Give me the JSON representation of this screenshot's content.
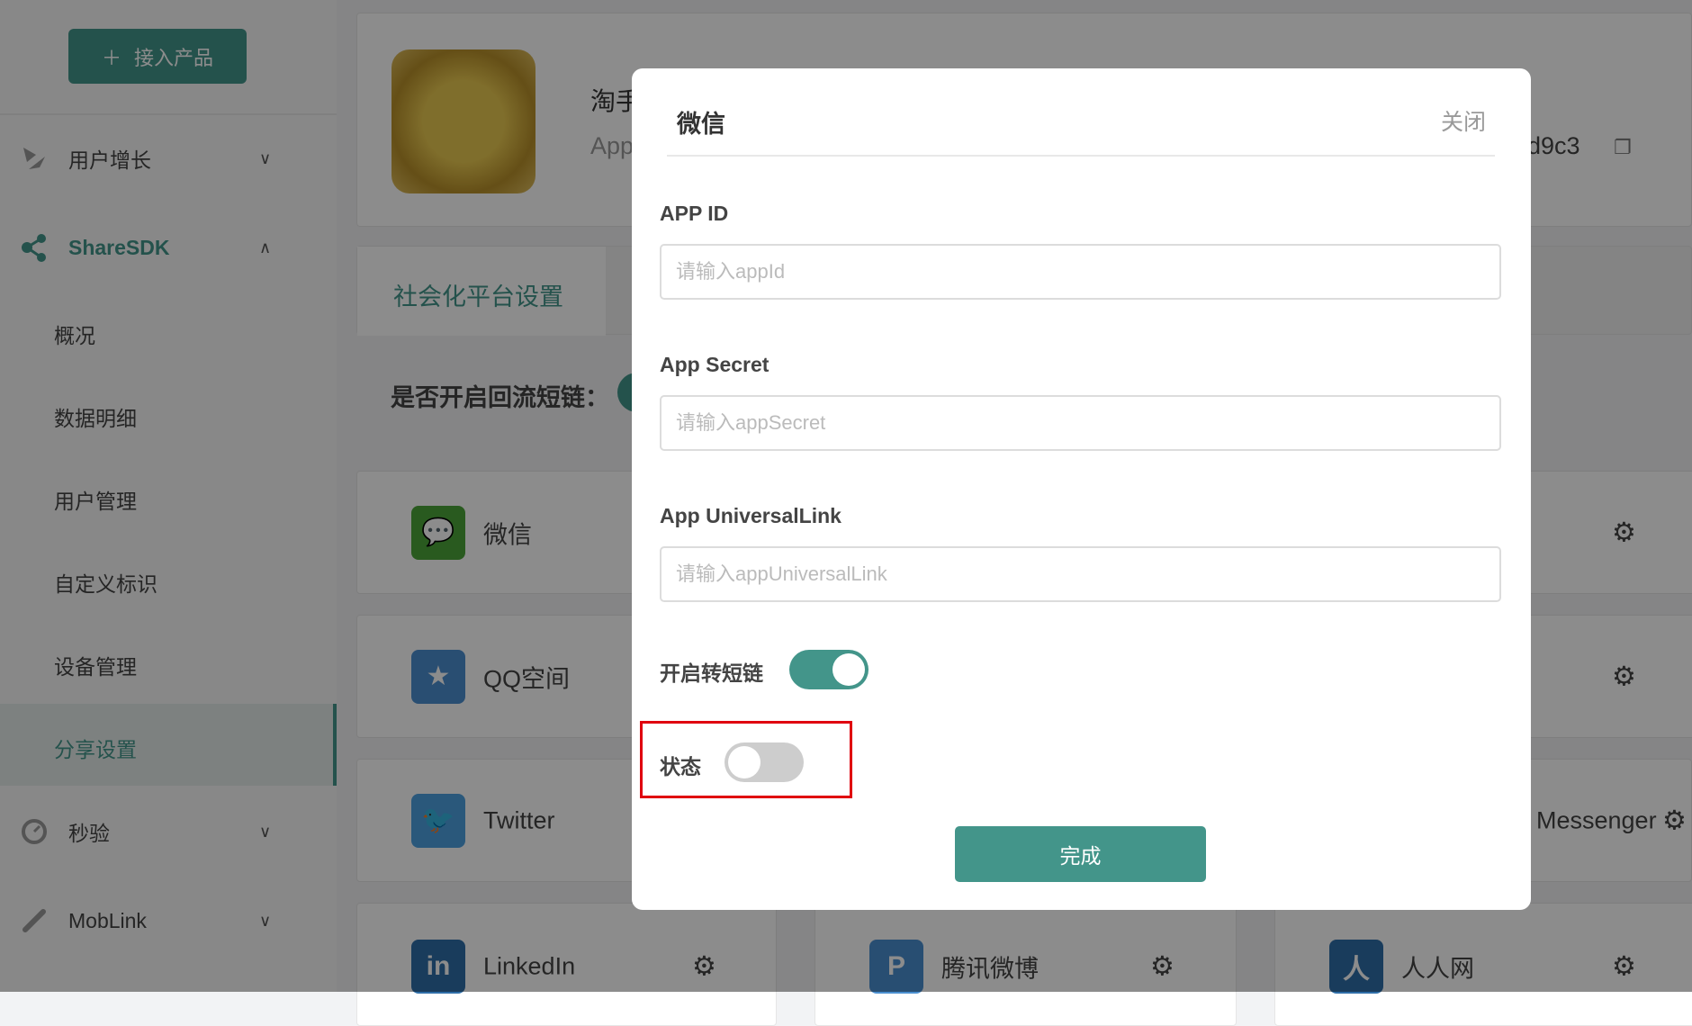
{
  "sidebar": {
    "add_button": "接入产品",
    "add_icon": "plus-icon",
    "groups": [
      {
        "label": "用户增长",
        "icon": "growth-icon",
        "expanded": false
      },
      {
        "label": "ShareSDK",
        "icon": "share-icon",
        "expanded": true
      },
      {
        "label": "秒验",
        "icon": "verify-icon",
        "expanded": false
      },
      {
        "label": "MobLink",
        "icon": "link-icon",
        "expanded": false
      }
    ],
    "sub_items": [
      "概况",
      "数据明细",
      "用户管理",
      "自定义标识",
      "设备管理",
      "分享设置"
    ],
    "active": "分享设置"
  },
  "app": {
    "name_partial": "淘手",
    "appkey_label_partial": "App",
    "appkey_partial": "d9c3",
    "copy_icon": "copy-icon"
  },
  "main": {
    "tab": "社会化平台设置",
    "shortlink_label": "是否开启回流短链："
  },
  "platforms": [
    {
      "name": "微信",
      "icon": "wechat-icon",
      "color": "#4ca43a"
    },
    {
      "name": "QQ空间",
      "icon": "qzone-icon",
      "color": "#4c8fd0"
    },
    {
      "name": "Twitter",
      "icon": "twitter-icon",
      "color": "#4da0e0"
    },
    {
      "name": "Messenger",
      "icon": "messenger-icon"
    },
    {
      "name": "LinkedIn",
      "icon": "linkedin-icon",
      "color": "#2f6ea8"
    },
    {
      "name": "腾讯微博",
      "icon": "tencent-weibo-icon",
      "color": "#4a8fd0"
    },
    {
      "name": "人人网",
      "icon": "renren-icon",
      "color": "#2f6ea8"
    }
  ],
  "modal": {
    "title": "微信",
    "close": "关闭",
    "fields": [
      {
        "label": "APP ID",
        "placeholder": "请输入appId",
        "value": ""
      },
      {
        "label": "App Secret",
        "placeholder": "请输入appSecret",
        "value": ""
      },
      {
        "label": "App UniversalLink",
        "placeholder": "请输入appUniversalLink",
        "value": ""
      }
    ],
    "shortlink_toggle": {
      "label": "开启转短链",
      "on": true
    },
    "status_toggle": {
      "label": "状态",
      "on": false
    },
    "done": "完成"
  },
  "colors": {
    "accent": "#43958a",
    "highlight": "#e0000f"
  }
}
